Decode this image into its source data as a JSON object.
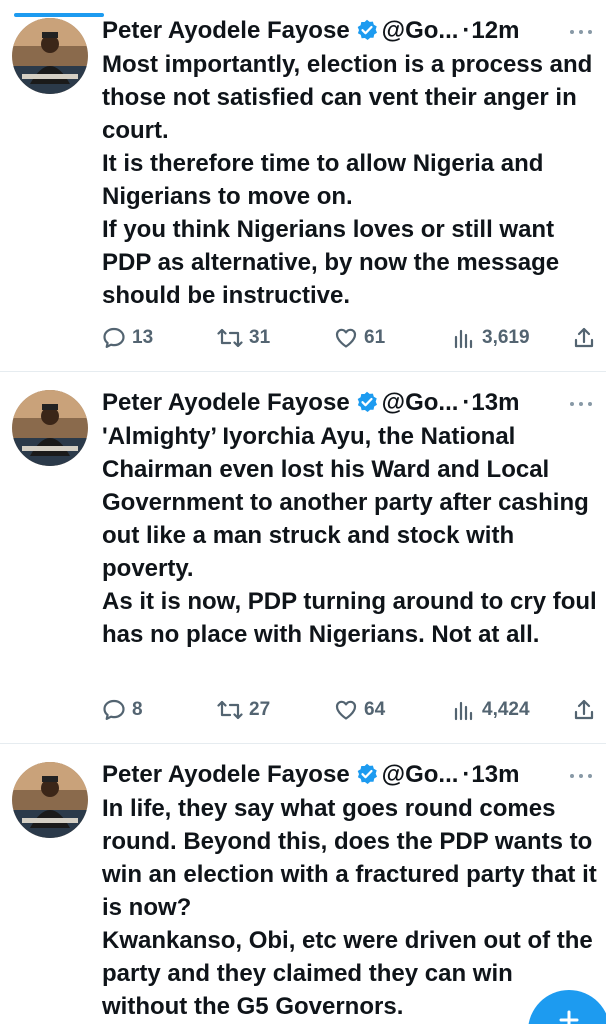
{
  "tweets": [
    {
      "author_name": "Peter Ayodele Fayose",
      "handle": "@Go...",
      "separator": "·",
      "time": "12m",
      "body": [
        "Most importantly, election is a process and those not satisfied can vent their anger in court.",
        "It is therefore time to allow Nigeria and Nigerians to move on.",
        "If you think Nigerians loves or still want PDP as alternative, by now the message should be instructive."
      ],
      "replies": "13",
      "retweets": "31",
      "likes": "61",
      "views": "3,619"
    },
    {
      "author_name": "Peter Ayodele Fayose",
      "handle": "@Go...",
      "separator": "·",
      "time": "13m",
      "body": [
        "'Almighty’ Iyorchia Ayu, the National Chairman even lost his Ward and Local Government to another party after cashing out like a man struck and stock with poverty.",
        "As it is now, PDP turning around to cry foul has no place with Nigerians. Not at all."
      ],
      "replies": "8",
      "retweets": "27",
      "likes": "64",
      "views": "4,424"
    },
    {
      "author_name": "Peter Ayodele Fayose",
      "handle": "@Go...",
      "separator": "·",
      "time": "13m",
      "body": [
        "In life, they say what goes round comes round. Beyond this, does the PDP wants to win an election with a fractured party that it is now?",
        "Kwankanso, Obi, etc were driven out of the party and they claimed they can win without the G5 Governors."
      ]
    }
  ],
  "colors": {
    "accent": "#1d9bf0",
    "text": "#0f1419",
    "secondary": "#536471",
    "divider": "#e6ecf0"
  },
  "icons": [
    "verified-badge-icon",
    "more-options-icon",
    "reply-icon",
    "retweet-icon",
    "like-icon",
    "views-icon",
    "share-icon",
    "compose-icon"
  ]
}
